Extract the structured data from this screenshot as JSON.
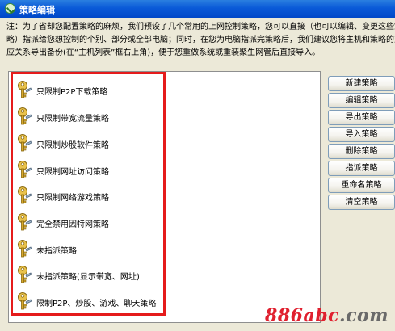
{
  "window": {
    "title": "策略编辑"
  },
  "note": {
    "lines": [
      "注：为了省却您配置策略的麻烦，我们预设了几个常用的上网控制策略，您可以直接（也可以编辑、变更这些策",
      "略）指派给您想控制的个别、部分或全部电脑；同时，在您为电脑指派完策略后，我们建议您将主机和策略的对",
      "应关系导出备份(在“主机列表”框右上角)，便于您重做系统或重装聚生网管后直接导入。"
    ]
  },
  "policies": [
    {
      "label": "只限制P2P下载策略",
      "icon": "key-icon"
    },
    {
      "label": "只限制带宽流量策略",
      "icon": "key-icon"
    },
    {
      "label": "只限制炒股软件策略",
      "icon": "key-icon"
    },
    {
      "label": "只限制网址访问策略",
      "icon": "key-icon"
    },
    {
      "label": "只限制网络游戏策略",
      "icon": "key-icon"
    },
    {
      "label": "完全禁用因特网策略",
      "icon": "key-icon"
    },
    {
      "label": "未指派策略",
      "icon": "key-icon"
    },
    {
      "label": "未指派策略(显示带宽、网址)",
      "icon": "key-icon"
    },
    {
      "label": "限制P2P、炒股、游戏、聊天策略",
      "icon": "key-icon"
    }
  ],
  "buttons": [
    {
      "label": "新建策略"
    },
    {
      "label": "编辑策略"
    },
    {
      "label": "导出策略"
    },
    {
      "label": "导入策略"
    },
    {
      "label": "删除策略"
    },
    {
      "label": "指派策略"
    },
    {
      "label": "重命名策略"
    },
    {
      "label": "清空策略"
    }
  ],
  "watermark": {
    "part1": "886abc",
    "part2": ".com"
  },
  "colors": {
    "titlebar": "#0a5ad8",
    "highlight_frame": "#e51b1b",
    "watermark_red": "#e0202f"
  }
}
